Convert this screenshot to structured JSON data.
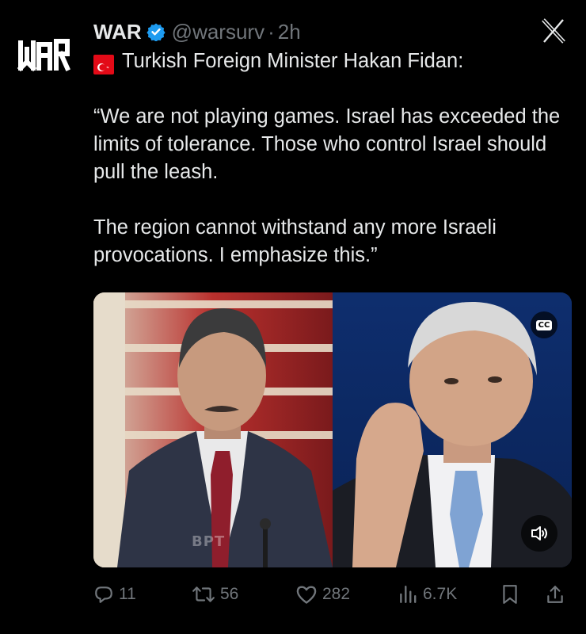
{
  "account": {
    "display_name": "WAR",
    "handle": "@warsurv",
    "separator": "·",
    "time": "2h",
    "avatar_text": "WAR",
    "verified": true
  },
  "tweet": {
    "flag": "turkey-flag",
    "line1": "Turkish Foreign Minister Hakan Fidan:",
    "paragraph1": "“We are not playing games. Israel has exceeded the limits of tolerance. Those who control Israel should pull the leash.",
    "paragraph2": "The region cannot withstand any more Israeli provocations. I emphasize this.”"
  },
  "media": {
    "left_image": "Hakan Fidan at podium",
    "right_image": "Benjamin Netanyahu",
    "watermark": "BPT",
    "cc_label": "CC",
    "cc_icon": "closed-captions-icon",
    "volume_icon": "speaker-icon"
  },
  "actions": {
    "replies": "11",
    "reposts": "56",
    "likes": "282",
    "views": "6.7K"
  },
  "colors": {
    "background": "#000000",
    "text": "#e7e9ea",
    "muted": "#71767b",
    "verified": "#1d9bf0",
    "flag": "#e30a17"
  }
}
